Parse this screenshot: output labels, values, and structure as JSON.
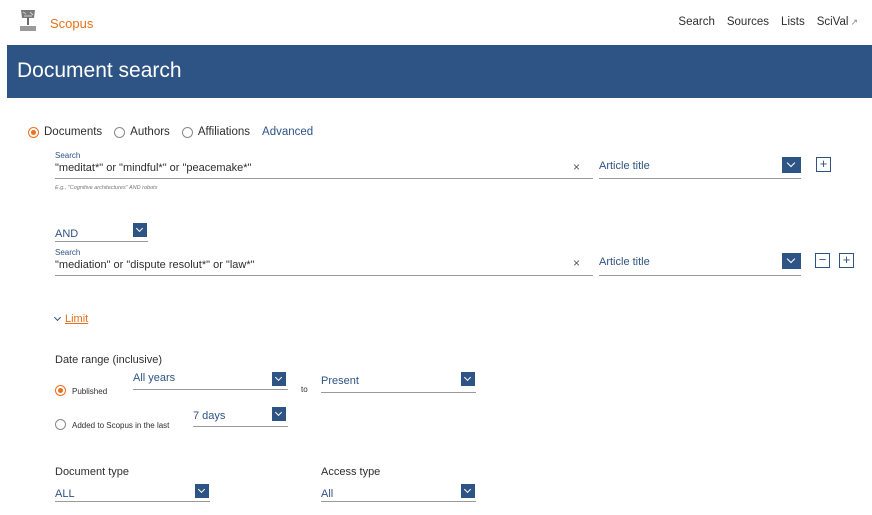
{
  "header": {
    "brand": "Scopus",
    "nav": [
      "Search",
      "Sources",
      "Lists",
      "SciVal"
    ],
    "external_icon": "↗"
  },
  "banner": {
    "title": "Document search"
  },
  "search_type": {
    "options": [
      "Documents",
      "Authors",
      "Affiliations"
    ],
    "selected": "Documents",
    "advanced_link": "Advanced"
  },
  "row1": {
    "label": "Search",
    "value": "\"meditat*\" or \"mindful*\" or \"peacemake*\"",
    "hint": "E.g., \"Cognitive architectures\" AND robots",
    "field": "Article title",
    "clear": "×",
    "add": "+"
  },
  "operator": {
    "value": "AND"
  },
  "row2": {
    "label": "Search",
    "value": "\"mediation\" or \"dispute resolut*\" or \"law*\"",
    "field": "Article title",
    "clear": "×",
    "remove": "−",
    "add": "+"
  },
  "limit": {
    "label": "Limit"
  },
  "date_range": {
    "title": "Date range (inclusive)",
    "published_label": "Published",
    "from_value": "All years",
    "to_label": "to",
    "to_value": "Present",
    "added_label": "Added to Scopus in the last",
    "added_value": "7 days",
    "selected": "Published"
  },
  "document_type": {
    "label": "Document type",
    "value": "ALL"
  },
  "access_type": {
    "label": "Access type",
    "value": "All"
  },
  "colors": {
    "brand_orange": "#e9711c",
    "brand_blue": "#2e5385"
  }
}
